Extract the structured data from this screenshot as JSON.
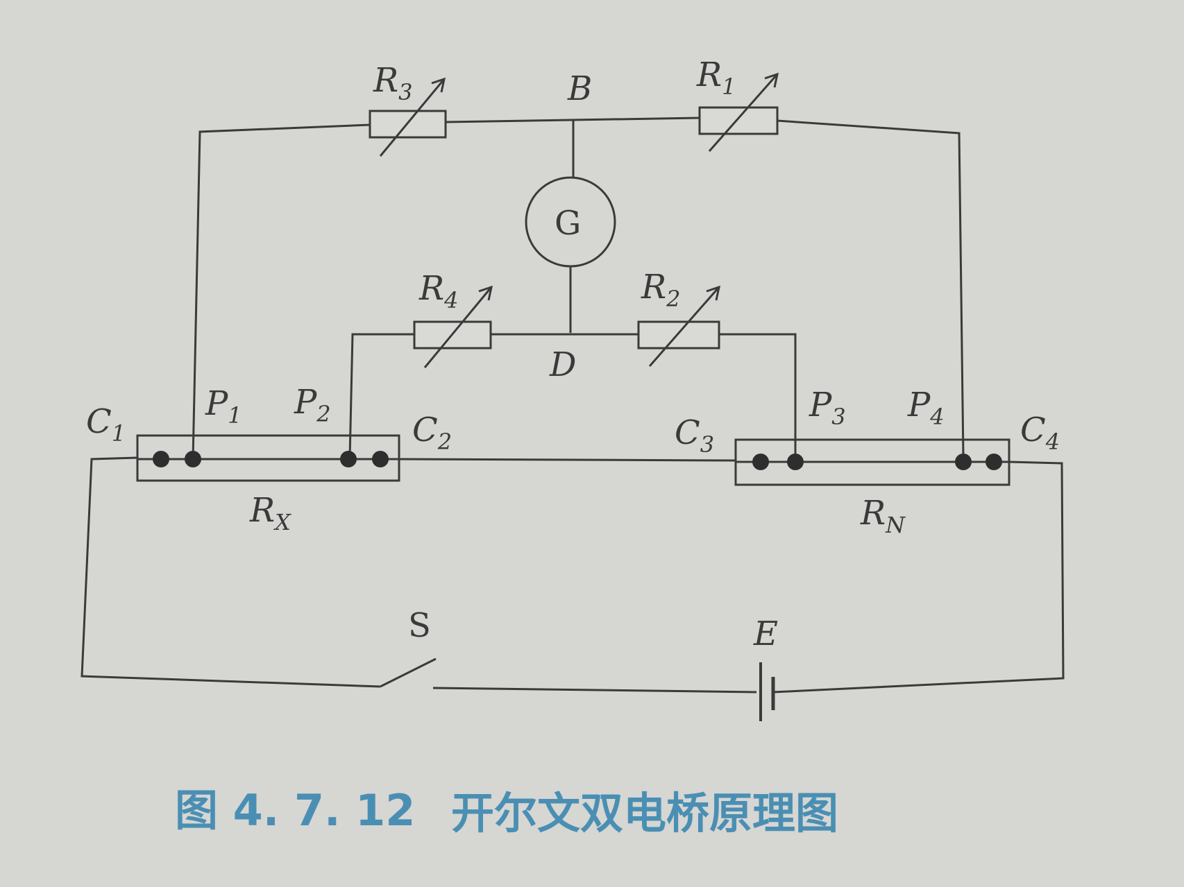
{
  "labels": {
    "R3": {
      "main": "R",
      "sub": "3"
    },
    "R1": {
      "main": "R",
      "sub": "1"
    },
    "R4": {
      "main": "R",
      "sub": "4"
    },
    "R2": {
      "main": "R",
      "sub": "2"
    },
    "B": "B",
    "D": "D",
    "G": "G",
    "C1": {
      "main": "C",
      "sub": "1"
    },
    "C2": {
      "main": "C",
      "sub": "2"
    },
    "C3": {
      "main": "C",
      "sub": "3"
    },
    "C4": {
      "main": "C",
      "sub": "4"
    },
    "P1": {
      "main": "P",
      "sub": "1"
    },
    "P2": {
      "main": "P",
      "sub": "2"
    },
    "P3": {
      "main": "P",
      "sub": "3"
    },
    "P4": {
      "main": "P",
      "sub": "4"
    },
    "RX": {
      "main": "R",
      "sub": "X"
    },
    "RN": {
      "main": "R",
      "sub": "N"
    },
    "S": "S",
    "E": "E"
  },
  "caption": {
    "number": "图 4. 7. 12",
    "title": "开尔文双电桥原理图"
  },
  "colors": {
    "line": "#3a3a3a",
    "caption": "#4a8fb3",
    "background": "#d6d6d3"
  }
}
